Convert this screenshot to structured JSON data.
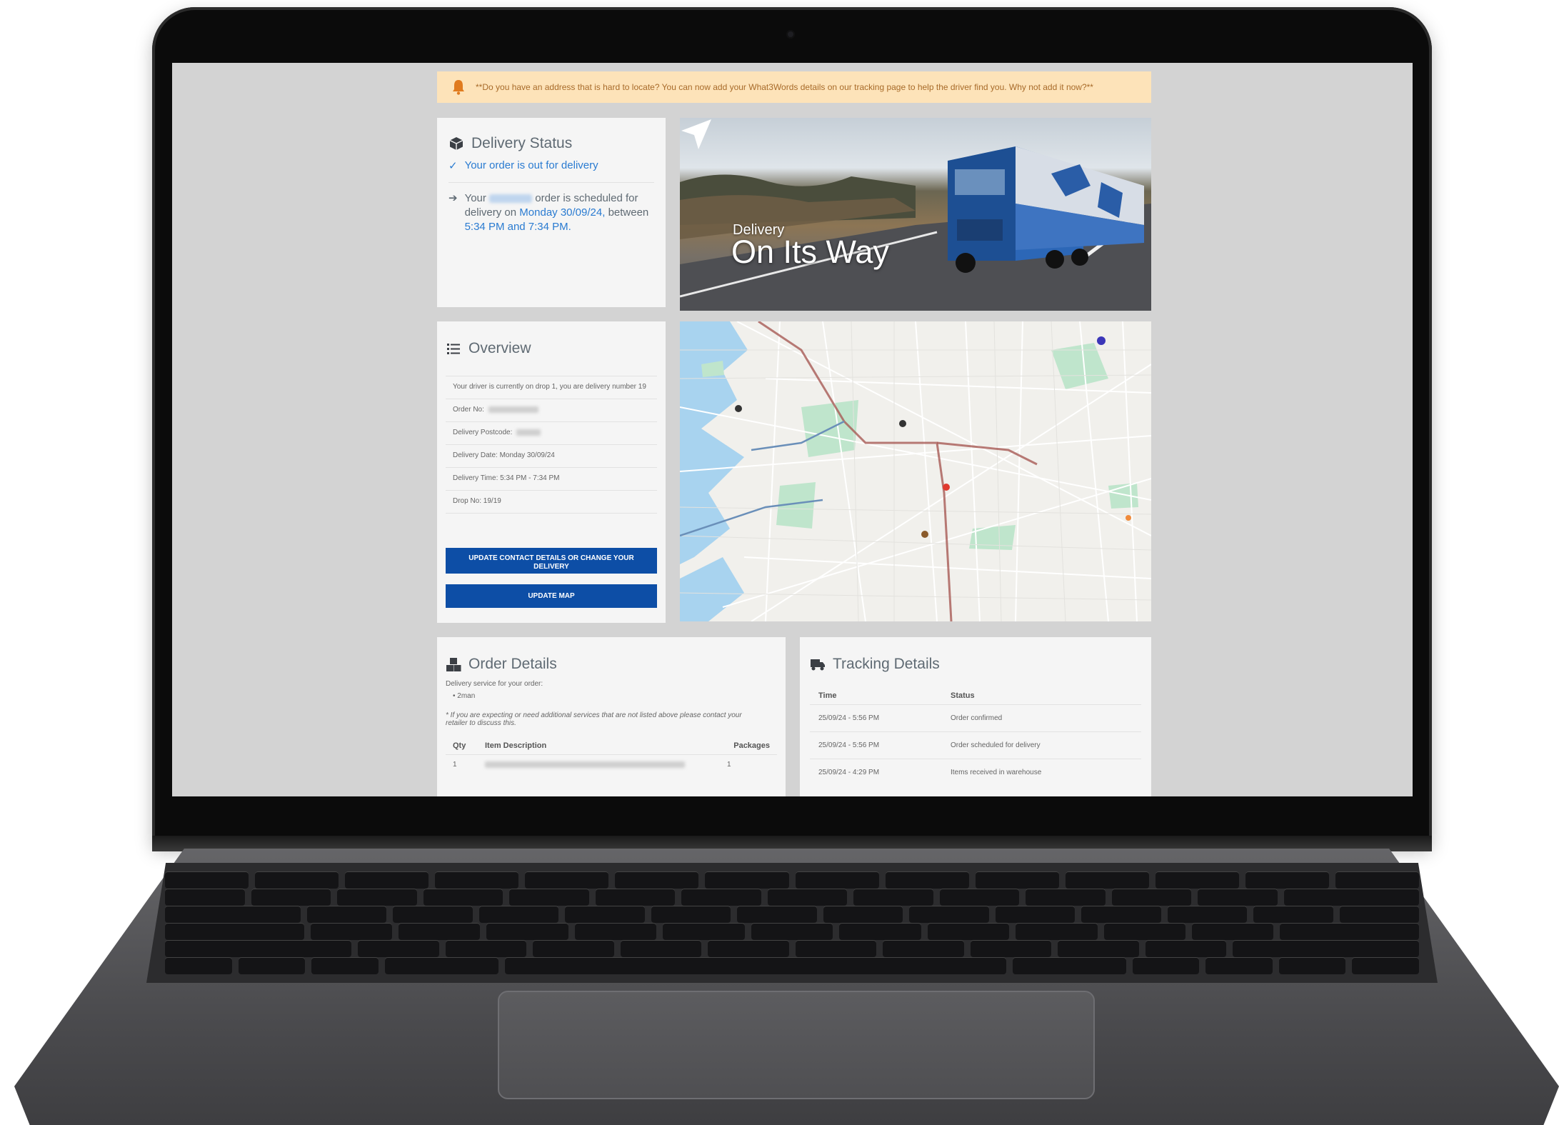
{
  "alert": {
    "message": "**Do you have an address that is hard to locate? You can now add your What3Words details on our tracking page to help the driver find you. Why not add it now?**"
  },
  "status": {
    "title": "Delivery Status",
    "line": "Your order is out for delivery",
    "schedule_prefix": "Your",
    "schedule_mid": "order is scheduled for delivery on",
    "schedule_date": "Monday 30/09/24,",
    "schedule_between": "between",
    "schedule_window": "5:34 PM and 7:34 PM."
  },
  "hero": {
    "small": "Delivery",
    "big": "On Its Way"
  },
  "overview": {
    "title": "Overview",
    "rows": [
      "Your driver is currently on drop 1, you are delivery number 19",
      "Order No:",
      "Delivery Postcode:",
      "Delivery Date: Monday 30/09/24",
      "Delivery Time: 5:34 PM - 7:34 PM",
      "Drop No: 19/19"
    ],
    "btn_contact": "UPDATE CONTACT DETAILS OR CHANGE YOUR DELIVERY",
    "btn_map": "UPDATE MAP"
  },
  "order": {
    "title": "Order Details",
    "service_label": "Delivery service for your order:",
    "service_item": "2man",
    "note": "* If you are expecting or need additional services that are not listed above please contact your retailer to discuss this.",
    "col_qty": "Qty",
    "col_desc": "Item Description",
    "col_packages": "Packages",
    "row_qty": "1",
    "row_packages": "1"
  },
  "tracking": {
    "title": "Tracking Details",
    "col_time": "Time",
    "col_status": "Status",
    "rows": [
      {
        "time": "25/09/24 - 5:56 PM",
        "status": "Order confirmed"
      },
      {
        "time": "25/09/24 - 5:56 PM",
        "status": "Order scheduled for delivery"
      },
      {
        "time": "25/09/24 - 4:29 PM",
        "status": "Items received in warehouse"
      }
    ]
  },
  "colors": {
    "primary_button": "#0d4ea6",
    "link_blue": "#2a7bd1",
    "alert_bg": "#fde3b9",
    "page_bg": "#d3d3d3"
  },
  "icons": [
    "bell-icon",
    "box-icon",
    "check-icon",
    "arrow-right-icon",
    "list-icon",
    "navigation-arrow-icon",
    "boxes-icon",
    "truck-icon"
  ]
}
